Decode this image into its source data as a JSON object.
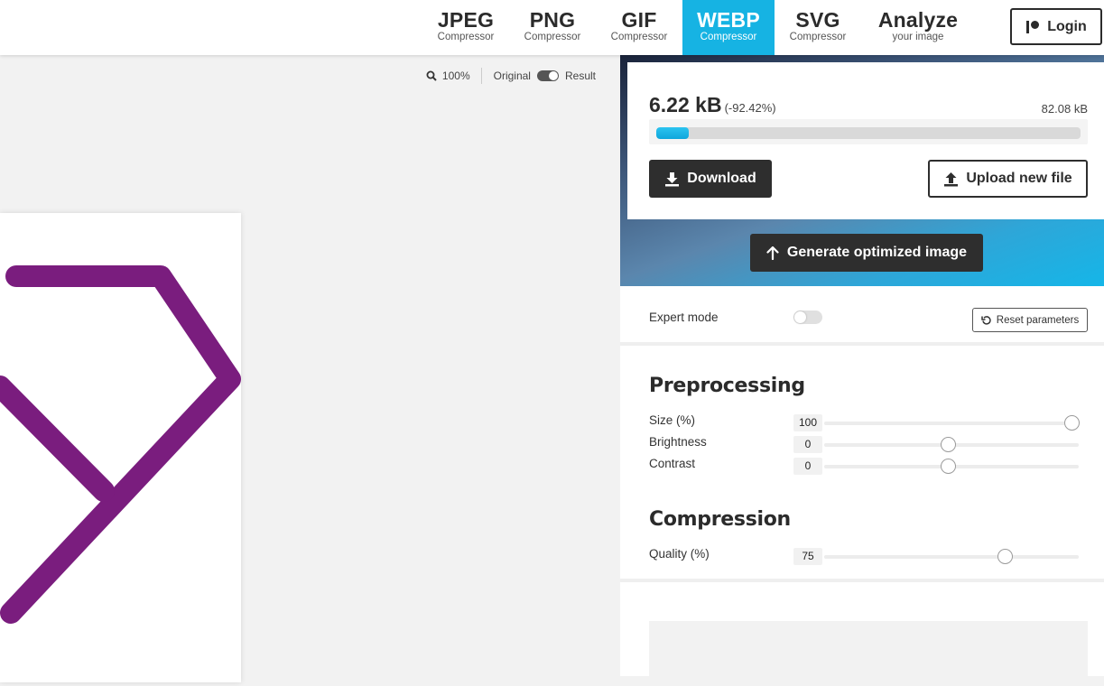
{
  "nav": {
    "tabs": [
      {
        "title": "JPEG",
        "subtitle": "Compressor"
      },
      {
        "title": "PNG",
        "subtitle": "Compressor"
      },
      {
        "title": "GIF",
        "subtitle": "Compressor"
      },
      {
        "title": "WEBP",
        "subtitle": "Compressor",
        "active": true
      },
      {
        "title": "SVG",
        "subtitle": "Compressor"
      },
      {
        "title": "Analyze",
        "subtitle": "your image"
      }
    ],
    "login_label": "Login",
    "active_color": "#16b3e3"
  },
  "preview": {
    "zoom": "100%",
    "original_label": "Original",
    "result_label": "Result",
    "stroke_color": "#7a1d7e"
  },
  "result": {
    "new_size": "6.22 kB",
    "reduction": "(-92.42%)",
    "original_size": "82.08 kB",
    "progress_fraction": 0.0758,
    "download_label": "Download",
    "upload_label": "Upload new file",
    "generate_label": "Generate optimized image"
  },
  "expert": {
    "label": "Expert mode",
    "enabled": false,
    "reset_label": "Reset parameters"
  },
  "preprocessing": {
    "title": "Preprocessing",
    "params": [
      {
        "label": "Size (%)",
        "value": "100",
        "fraction": 1.0
      },
      {
        "label": "Brightness",
        "value": "0",
        "fraction": 0.5
      },
      {
        "label": "Contrast",
        "value": "0",
        "fraction": 0.5
      }
    ]
  },
  "compression": {
    "title": "Compression",
    "params": [
      {
        "label": "Quality (%)",
        "value": "75",
        "fraction": 0.73
      }
    ]
  }
}
